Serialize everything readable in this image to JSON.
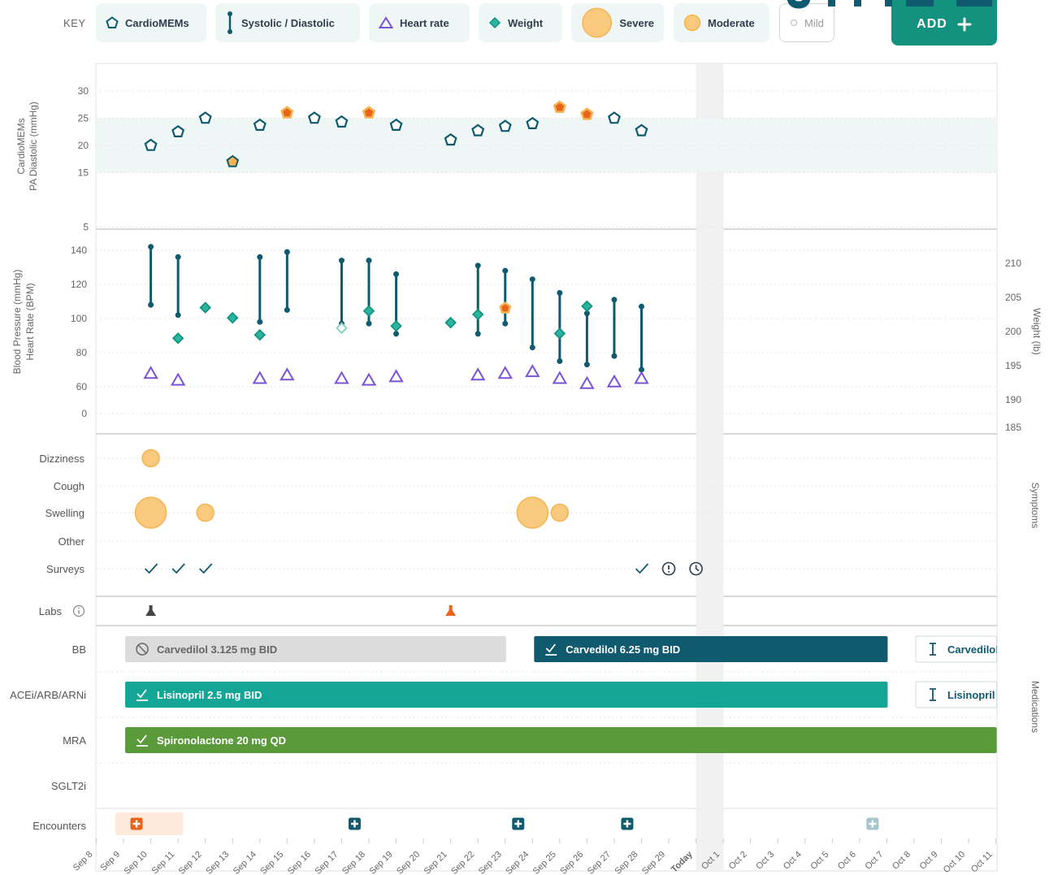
{
  "key": {
    "label": "KEY",
    "items": [
      {
        "label": "CardioMEMs",
        "icon": "pentagon-icon"
      },
      {
        "label": "Systolic / Diastolic",
        "icon": "bp-range-icon"
      },
      {
        "label": "Heart rate",
        "icon": "triangle-icon"
      },
      {
        "label": "Weight",
        "icon": "diamond-icon"
      },
      {
        "label": "Severe",
        "icon": "large-circle-icon"
      },
      {
        "label": "Moderate",
        "icon": "medium-circle-icon"
      },
      {
        "label": "Mild",
        "icon": "small-circle-icon"
      }
    ],
    "add_label": "ADD",
    "add_icon": "plus-icon"
  },
  "colors": {
    "navy": "#0f5a6e",
    "teal": "#13a596",
    "green": "#5b9a3b",
    "purple": "#7b52d6",
    "symptom": "#f9c97d",
    "alert": "#e8631c",
    "grey_bar": "#dcdcdc",
    "band": "#eef7f6"
  },
  "dates": [
    "Sep 8",
    "Sep 9",
    "Sep 10",
    "Sep 11",
    "Sep 12",
    "Sep 13",
    "Sep 14",
    "Sep 15",
    "Sep 16",
    "Sep 17",
    "Sep 18",
    "Sep 19",
    "Sep 20",
    "Sep 21",
    "Sep 22",
    "Sep 23",
    "Sep 24",
    "Sep 25",
    "Sep 26",
    "Sep 27",
    "Sep 28",
    "Sep 29",
    "Today",
    "Oct 1",
    "Oct 2",
    "Oct 3",
    "Oct 4",
    "Oct 5",
    "Oct 6",
    "Oct 7",
    "Oct 8",
    "Oct 9",
    "Oct 10",
    "Oct 11"
  ],
  "today_label": "Today",
  "cardiomems": {
    "axis_label_1": "CardioMEMs",
    "axis_label_2": "PA Diastolic (mmHg)",
    "ticks": [
      30,
      25,
      20,
      15,
      5
    ],
    "target_range": [
      15,
      25
    ],
    "points": [
      {
        "date": "Sep 10",
        "value": 20,
        "flag": false
      },
      {
        "date": "Sep 11",
        "value": 22.5,
        "flag": false
      },
      {
        "date": "Sep 12",
        "value": 25,
        "flag": false
      },
      {
        "date": "Sep 13",
        "value": 17,
        "flag": "moderate"
      },
      {
        "date": "Sep 14",
        "value": 23.7,
        "flag": false
      },
      {
        "date": "Sep 15",
        "value": 26,
        "flag": "severe"
      },
      {
        "date": "Sep 16",
        "value": 25,
        "flag": false
      },
      {
        "date": "Sep 17",
        "value": 24.3,
        "flag": false
      },
      {
        "date": "Sep 18",
        "value": 26,
        "flag": "severe"
      },
      {
        "date": "Sep 19",
        "value": 23.7,
        "flag": false
      },
      {
        "date": "Sep 21",
        "value": 21,
        "flag": false
      },
      {
        "date": "Sep 22",
        "value": 22.7,
        "flag": false
      },
      {
        "date": "Sep 23",
        "value": 23.5,
        "flag": false
      },
      {
        "date": "Sep 24",
        "value": 24,
        "flag": false
      },
      {
        "date": "Sep 25",
        "value": 27,
        "flag": "severe"
      },
      {
        "date": "Sep 26",
        "value": 25.7,
        "flag": "severe"
      },
      {
        "date": "Sep 27",
        "value": 25,
        "flag": false
      },
      {
        "date": "Sep 28",
        "value": 22.7,
        "flag": false
      }
    ]
  },
  "vitals": {
    "axis_label_1": "Blood Pressure (mmHg)",
    "axis_label_2": "Heart Rate (BPM)",
    "weight_label": "Weight (lb)",
    "left_ticks": [
      140,
      120,
      100,
      80,
      60,
      0
    ],
    "right_ticks": [
      210,
      205,
      200,
      195,
      190,
      185
    ],
    "bp": [
      {
        "date": "Sep 10",
        "sys": 142,
        "dia": 108
      },
      {
        "date": "Sep 11",
        "sys": 136,
        "dia": 102
      },
      {
        "date": "Sep 14",
        "sys": 136,
        "dia": 98
      },
      {
        "date": "Sep 15",
        "sys": 139,
        "dia": 105
      },
      {
        "date": "Sep 17",
        "sys": 134,
        "dia": 97
      },
      {
        "date": "Sep 18",
        "sys": 134,
        "dia": 97
      },
      {
        "date": "Sep 19",
        "sys": 126,
        "dia": 91
      },
      {
        "date": "Sep 22",
        "sys": 131,
        "dia": 91
      },
      {
        "date": "Sep 23",
        "sys": 128,
        "dia": 97,
        "flag": true
      },
      {
        "date": "Sep 24",
        "sys": 123,
        "dia": 83
      },
      {
        "date": "Sep 25",
        "sys": 115,
        "dia": 75
      },
      {
        "date": "Sep 26",
        "sys": 103,
        "dia": 73
      },
      {
        "date": "Sep 27",
        "sys": 111,
        "dia": 78
      },
      {
        "date": "Sep 28",
        "sys": 107,
        "dia": 70
      }
    ],
    "heart_rate": [
      {
        "date": "Sep 10",
        "value": 68
      },
      {
        "date": "Sep 11",
        "value": 64
      },
      {
        "date": "Sep 14",
        "value": 65
      },
      {
        "date": "Sep 15",
        "value": 67
      },
      {
        "date": "Sep 17",
        "value": 65
      },
      {
        "date": "Sep 18",
        "value": 64
      },
      {
        "date": "Sep 19",
        "value": 66
      },
      {
        "date": "Sep 22",
        "value": 67
      },
      {
        "date": "Sep 23",
        "value": 68
      },
      {
        "date": "Sep 24",
        "value": 69
      },
      {
        "date": "Sep 25",
        "value": 65
      },
      {
        "date": "Sep 26",
        "value": 62
      },
      {
        "date": "Sep 27",
        "value": 63
      },
      {
        "date": "Sep 28",
        "value": 65
      }
    ],
    "weight": [
      {
        "date": "Sep 11",
        "value": 199
      },
      {
        "date": "Sep 12",
        "value": 203.5
      },
      {
        "date": "Sep 13",
        "value": 202
      },
      {
        "date": "Sep 14",
        "value": 199.5
      },
      {
        "date": "Sep 17",
        "value": 200.5,
        "hollow": true
      },
      {
        "date": "Sep 18",
        "value": 203
      },
      {
        "date": "Sep 19",
        "value": 200.8
      },
      {
        "date": "Sep 21",
        "value": 201.3
      },
      {
        "date": "Sep 22",
        "value": 202.5
      },
      {
        "date": "Sep 25",
        "value": 199.7
      },
      {
        "date": "Sep 26",
        "value": 203.7
      }
    ]
  },
  "symptoms": {
    "label": "Symptoms",
    "rows": [
      "Dizziness",
      "Cough",
      "Swelling",
      "Other",
      "Surveys"
    ],
    "points": [
      {
        "row": "Dizziness",
        "date": "Sep 10",
        "severity": "moderate"
      },
      {
        "row": "Swelling",
        "date": "Sep 10",
        "severity": "severe"
      },
      {
        "row": "Swelling",
        "date": "Sep 12",
        "severity": "moderate"
      },
      {
        "row": "Swelling",
        "date": "Sep 24",
        "severity": "severe"
      },
      {
        "row": "Swelling",
        "date": "Sep 25",
        "severity": "moderate"
      }
    ],
    "surveys": [
      {
        "date": "Sep 10",
        "status": "check-icon"
      },
      {
        "date": "Sep 11",
        "status": "check-icon"
      },
      {
        "date": "Sep 12",
        "status": "check-icon"
      },
      {
        "date": "Sep 28",
        "status": "check-icon"
      },
      {
        "date": "Sep 29",
        "status": "alert-icon"
      },
      {
        "date": "Today",
        "status": "clock-icon"
      }
    ]
  },
  "labs": {
    "label": "Labs",
    "info_icon": "info-icon",
    "points": [
      {
        "date": "Sep 10",
        "flag": false
      },
      {
        "date": "Sep 21",
        "flag": true
      }
    ]
  },
  "medications": {
    "label": "Medications",
    "rows": [
      "BB",
      "ACEi/ARB/ARNi",
      "MRA",
      "SGLT2i"
    ],
    "bars": [
      {
        "row": "BB",
        "label": "Carvedilol 3.125 mg BID",
        "start": "Sep 9",
        "end": "Sep 23",
        "style": "stopped",
        "icon": "stop-icon"
      },
      {
        "row": "BB",
        "label": "Carvedilol 6.25 mg BID",
        "start": "Sep 24",
        "end": "Oct 7",
        "style": "navy",
        "icon": "check-icon"
      },
      {
        "row": "BB",
        "label": "Carvedilol",
        "start": "Oct 8",
        "end": "Oct 11",
        "style": "planned",
        "icon": "titrate-icon"
      },
      {
        "row": "ACEi/ARB/ARNi",
        "label": "Lisinopril 2.5 mg BID",
        "start": "Sep 9",
        "end": "Oct 7",
        "style": "teal",
        "icon": "check-icon"
      },
      {
        "row": "ACEi/ARB/ARNi",
        "label": "Lisinopril",
        "start": "Oct 8",
        "end": "Oct 11",
        "style": "planned",
        "icon": "titrate-icon"
      },
      {
        "row": "MRA",
        "label": "Spironolactone 20 mg QD",
        "start": "Sep 9",
        "end": "Oct 11",
        "style": "green",
        "icon": "check-icon"
      }
    ]
  },
  "encounters": {
    "label": "Encounters",
    "items": [
      {
        "date": "Sep 9",
        "kind": "hospital",
        "span_end": "Sep 11"
      },
      {
        "date": "Sep 17",
        "kind": "visit"
      },
      {
        "date": "Sep 23",
        "kind": "visit"
      },
      {
        "date": "Sep 27",
        "kind": "visit"
      },
      {
        "date": "Oct 6",
        "kind": "planned"
      }
    ]
  }
}
